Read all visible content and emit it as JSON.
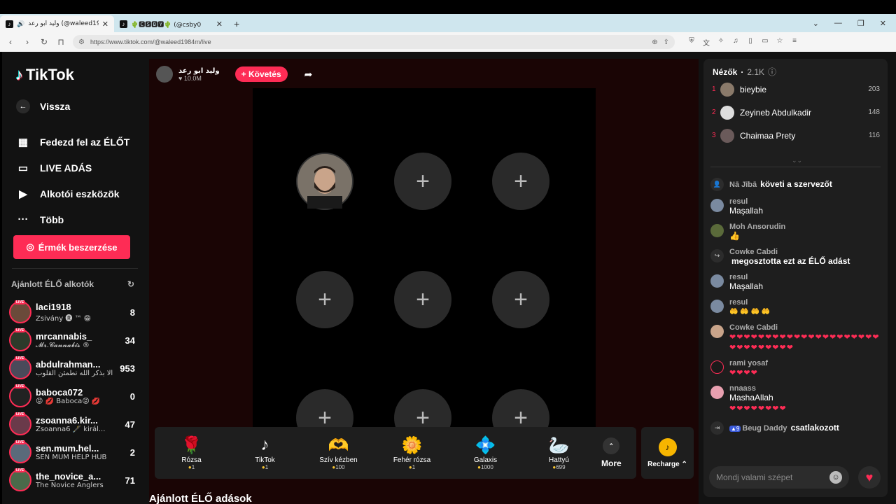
{
  "browser": {
    "tabs": [
      {
        "title": "وليد ابو رعد (@waleed1984m)",
        "active": true
      },
      {
        "title": "🌵🅲🆂🅱🆈🌵 (@csby0",
        "active": false
      }
    ],
    "new_tab": "+",
    "url": "https://www.tiktok.com/@waleed1984m/live"
  },
  "sidebar": {
    "logo": "TikTok",
    "back_label": "Vissza",
    "menu": [
      {
        "label": "Fedezd fel az ÉLŐT",
        "icon": "calendar-icon"
      },
      {
        "label": "LIVE ADÁS",
        "icon": "camera-icon"
      },
      {
        "label": "Alkotói eszközök",
        "icon": "tools-icon"
      },
      {
        "label": "Több",
        "icon": "more-icon"
      }
    ],
    "coins_button": "Érmék beszerzése",
    "recommended_title": "Ajánlott ÉLŐ alkotók",
    "live_tag": "LIVE",
    "creators": [
      {
        "name": "laci1918",
        "sub": "Zsivány 🅡 ™ 😁",
        "count": "8"
      },
      {
        "name": "mrcannabis_",
        "sub": "𝓜𝓻.𝓒𝓪𝓷𝓷𝓪𝓫𝓲𝓼 ®",
        "count": "34"
      },
      {
        "name": "abdulrahman...",
        "sub": "ألا بذكر الله تطمئن القلوب ...",
        "count": "953"
      },
      {
        "name": "baboca072",
        "sub": "😡 💋 Baboca😡 💋",
        "count": "0"
      },
      {
        "name": "zsoanna6.kir...",
        "sub": "Zsoanna6 🖋️ királ...",
        "count": "47"
      },
      {
        "name": "sen.mum.hel...",
        "sub": "SEN MUM HELP HUB",
        "count": "2"
      },
      {
        "name": "the_novice_a...",
        "sub": "The Novice Anglers",
        "count": "71"
      }
    ]
  },
  "main": {
    "host_name": "وليد ابو رعد",
    "host_likes": "10.0M",
    "follow_label": "+ Követés",
    "gifts": [
      {
        "name": "Rózsa",
        "price": "1",
        "icon": "🌹"
      },
      {
        "name": "TikTok",
        "price": "1",
        "icon": "♪"
      },
      {
        "name": "Szív kézben",
        "price": "100",
        "icon": "🫶"
      },
      {
        "name": "Fehér rózsa",
        "price": "1",
        "icon": "🌼"
      },
      {
        "name": "Galaxis",
        "price": "1000",
        "icon": "💠"
      },
      {
        "name": "Hattyú",
        "price": "699",
        "icon": "🦢"
      }
    ],
    "more_label": "More",
    "recharge_label": "Recharge ⌃",
    "lower_title": "Ajánlott ÉLŐ adások"
  },
  "chat": {
    "viewers_title": "Nézők",
    "viewers_count": "2.1K",
    "top_viewers": [
      {
        "rank": "1",
        "name": "bieybie",
        "score": "203"
      },
      {
        "rank": "2",
        "name": "Zeyineb Abdulkadir",
        "score": "148"
      },
      {
        "rank": "3",
        "name": "Chaimaa Prety",
        "score": "116"
      }
    ],
    "messages": [
      {
        "name": "Nā Jībā",
        "inline": "követi a szervezőt"
      },
      {
        "name": "resul",
        "text": "Maşallah"
      },
      {
        "name": "Moh Ansorudin",
        "text": "👍"
      },
      {
        "name": "Cowke Cabdi",
        "text": "megosztotta ezt az ÉLŐ adást"
      },
      {
        "name": "resul",
        "text": "Maşallah"
      },
      {
        "name": "resul",
        "text": "🤲 🤲 🤲 🤲"
      },
      {
        "name": "Cowke Cabdi",
        "text": "❤❤❤❤❤❤❤❤❤❤❤❤❤❤❤❤❤❤❤❤❤❤❤❤❤❤❤❤❤❤"
      },
      {
        "name": "rami yosaf",
        "text": "❤❤❤❤"
      },
      {
        "name": "nnaass",
        "text": "MashaAllah",
        "text2": "❤❤❤❤❤❤❤❤"
      },
      {
        "name": "Beug Daddy",
        "badge": "9",
        "inline": "csatlakozott"
      }
    ],
    "input_placeholder": "Mondj valami szépet"
  }
}
